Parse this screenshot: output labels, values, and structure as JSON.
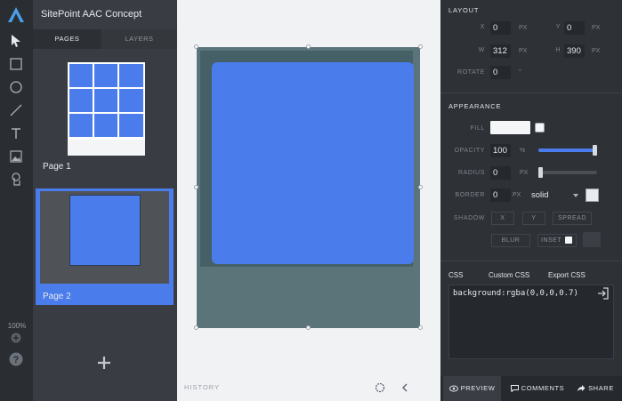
{
  "app": {
    "title": "SitePoint AAC Concept"
  },
  "tools": {
    "zoom_label": "100%"
  },
  "pages_panel": {
    "tabs": [
      "PAGES",
      "LAYERS"
    ],
    "pages": [
      {
        "label": "Page 1"
      },
      {
        "label": "Page 2"
      }
    ]
  },
  "canvas": {
    "history_label": "HISTORY"
  },
  "layout": {
    "section_title": "LAYOUT",
    "x_label": "X",
    "x_value": "0",
    "x_unit": "PX",
    "y_label": "Y",
    "y_value": "0",
    "y_unit": "PX",
    "w_label": "W",
    "w_value": "312",
    "w_unit": "PX",
    "h_label": "H",
    "h_value": "390",
    "h_unit": "PX",
    "rotate_label": "ROTATE",
    "rotate_value": "0",
    "rotate_unit": "°"
  },
  "appearance": {
    "section_title": "APPEARANCE",
    "fill_label": "FILL",
    "opacity_label": "OPACITY",
    "opacity_value": "100",
    "opacity_unit": "%",
    "opacity_level": 1.0,
    "radius_label": "RADIUS",
    "radius_value": "0",
    "radius_unit": "PX",
    "radius_level": 0.0,
    "border_label": "BORDER",
    "border_value": "0",
    "border_unit": "PX",
    "border_style": "solid",
    "shadow_label": "SHADOW",
    "shadow_x": "X",
    "shadow_y": "Y",
    "shadow_spread": "SPREAD",
    "shadow_blur": "BLUR",
    "shadow_inset": "INSET"
  },
  "css_panel": {
    "tabs": [
      "CSS",
      "Custom CSS",
      "Export CSS"
    ],
    "code": "background:rgba(0,0,0,0.7)"
  },
  "bottom_bar": {
    "preview": "PREVIEW",
    "comments": "COMMENTS",
    "share": "SHARE"
  },
  "colors": {
    "accent": "#4a7ceb",
    "selected_page": "#4a7ceb",
    "panel": "#393c42",
    "canvas": "#f1f2f4"
  }
}
